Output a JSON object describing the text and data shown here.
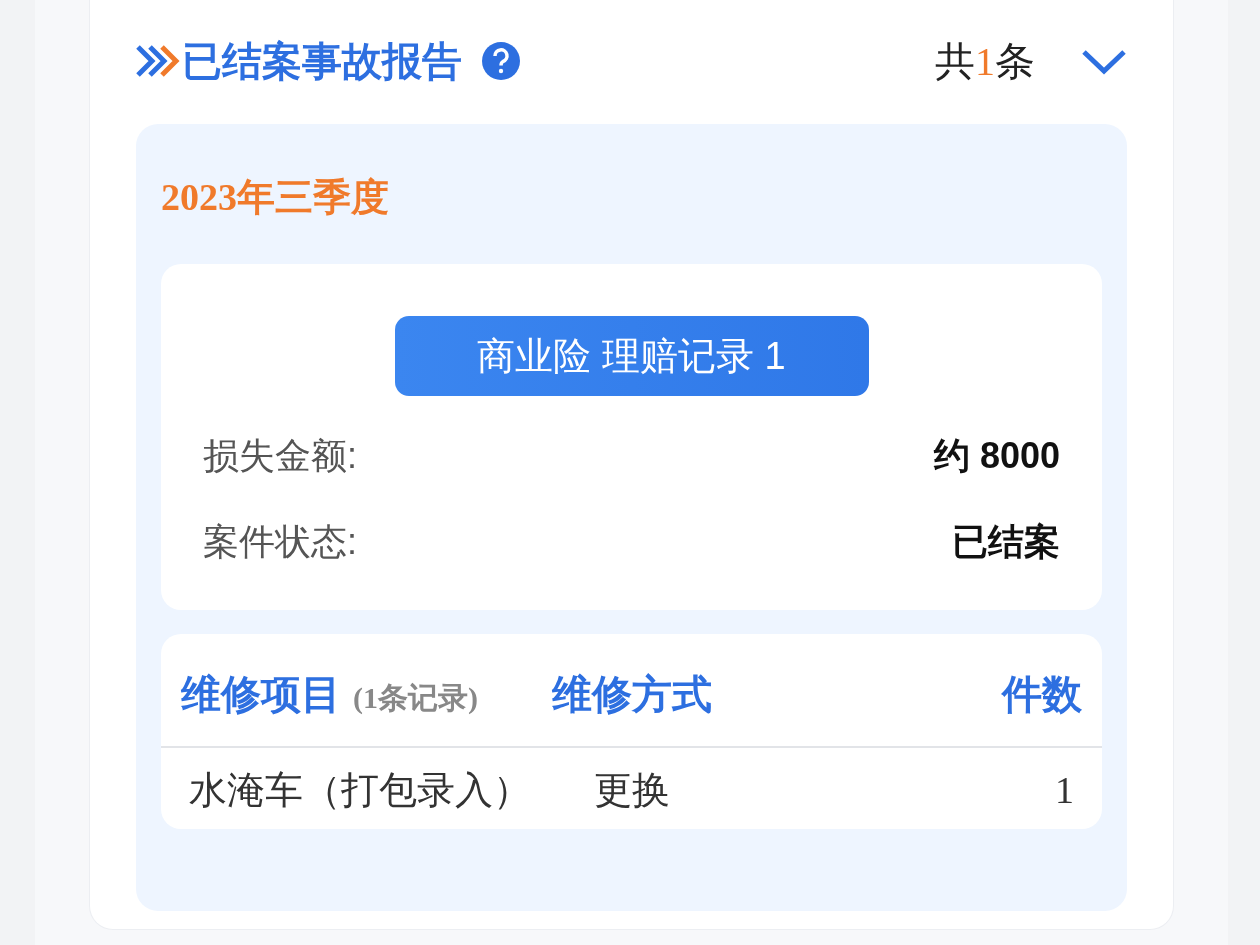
{
  "section": {
    "title": "已结案事故报告",
    "count_prefix": "共",
    "count": "1",
    "count_suffix": "条",
    "expanded": true
  },
  "period": "2023年三季度",
  "claim": {
    "button": "商业险 理赔记录 1",
    "fields": [
      {
        "label": "损失金额:",
        "value": "约 8000"
      },
      {
        "label": "案件状态:",
        "value": "已结案"
      }
    ]
  },
  "repairs": {
    "columns": [
      {
        "label": "维修项目",
        "note": "(1条记录)"
      },
      {
        "label": "维修方式"
      },
      {
        "label": "件数"
      }
    ],
    "rows": [
      [
        "水淹车（打包录入）",
        "更换",
        "1"
      ]
    ]
  }
}
